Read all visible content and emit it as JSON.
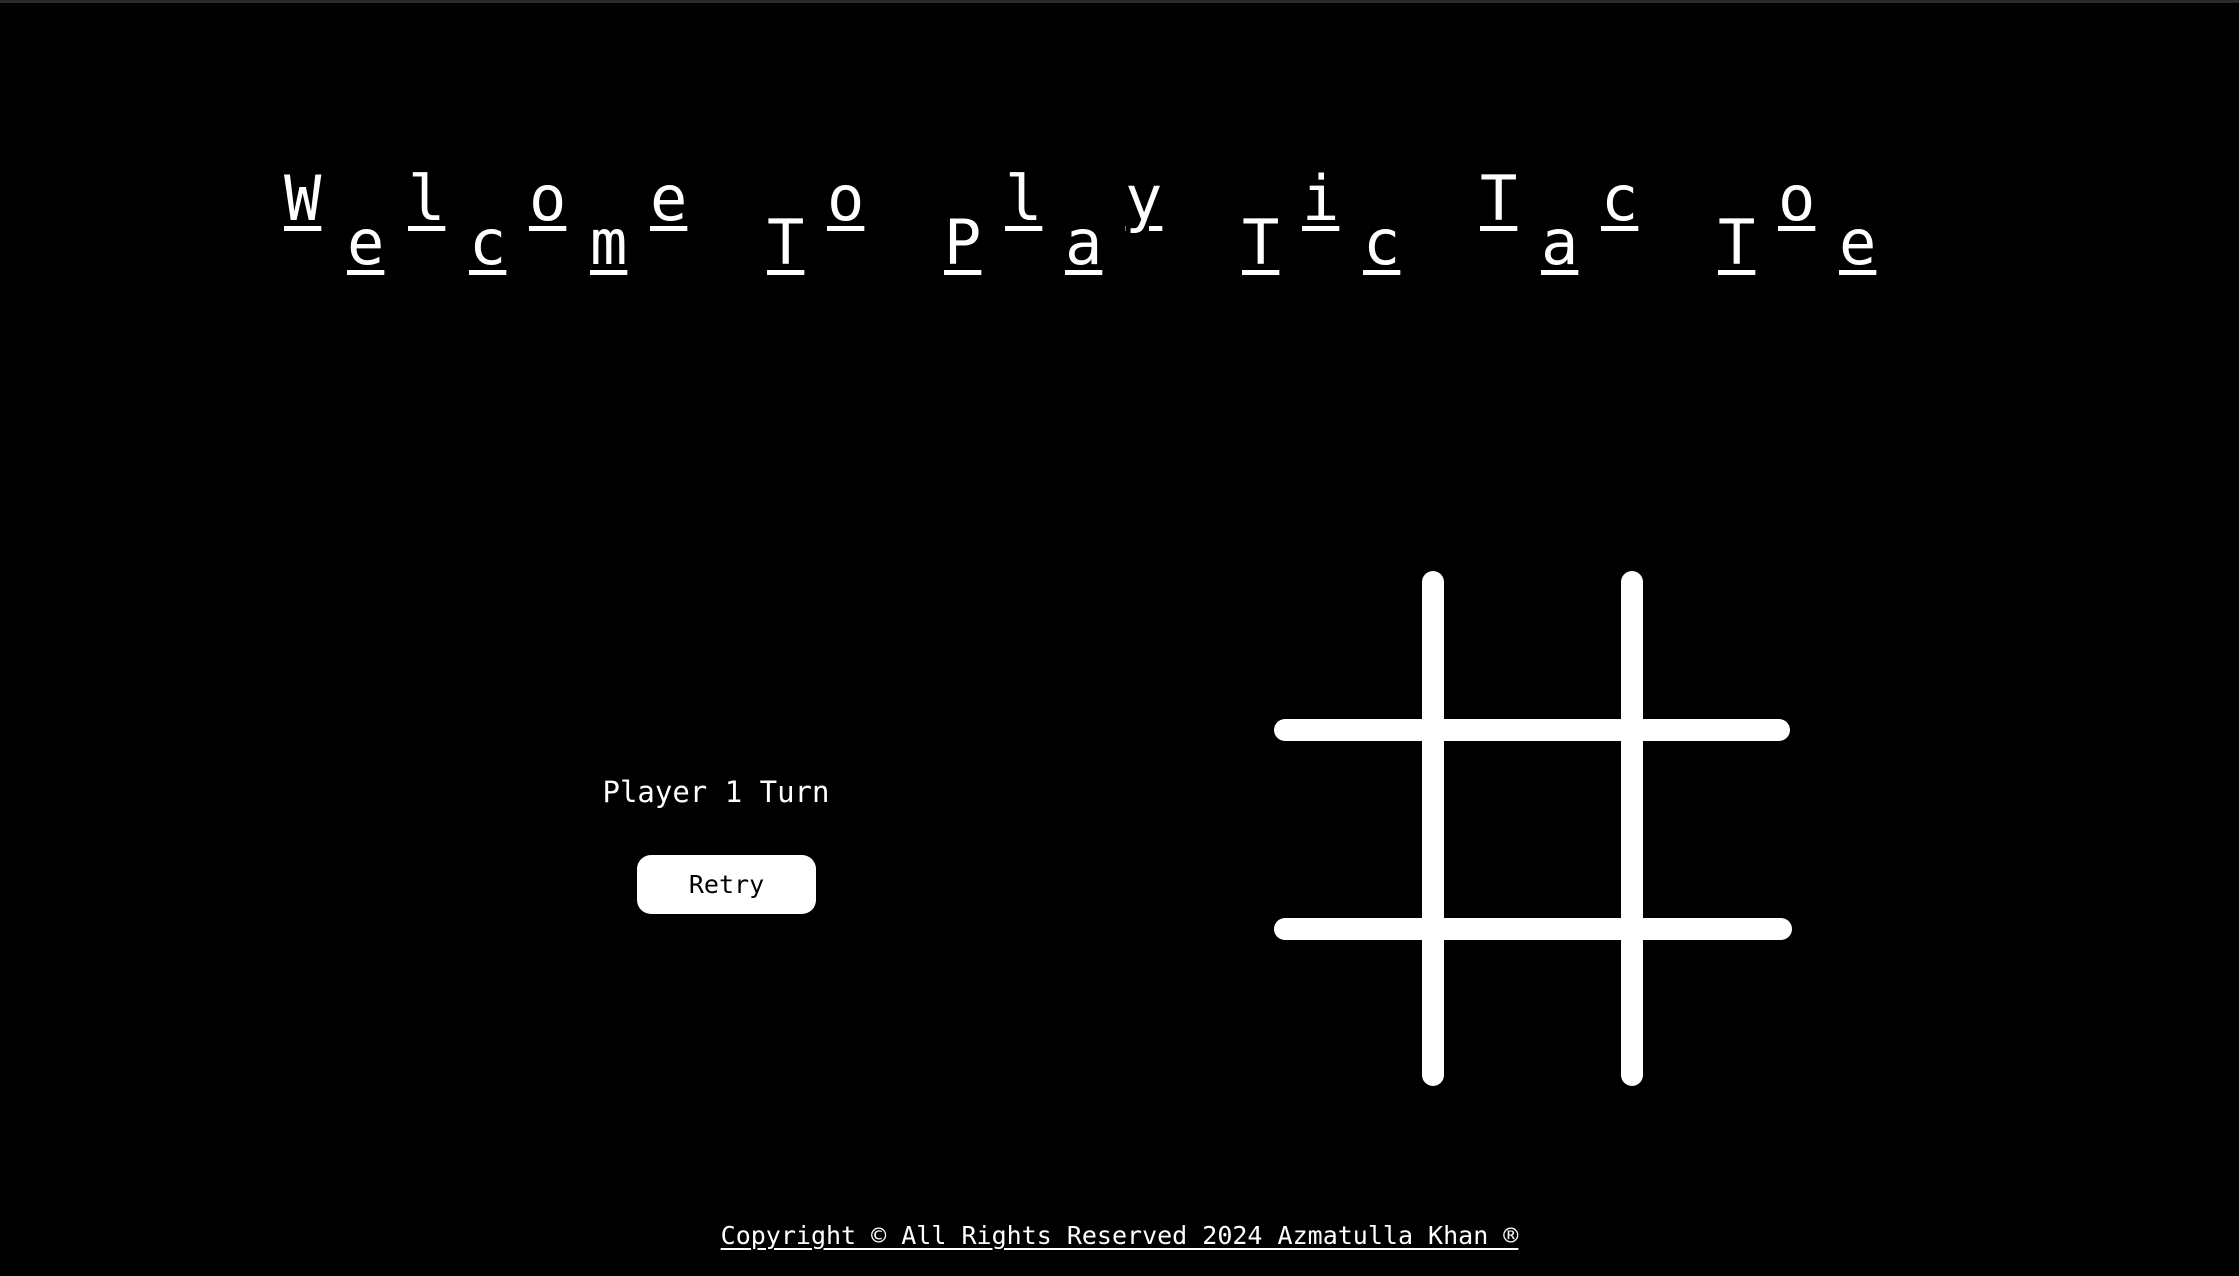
{
  "header": {
    "title": "Welcome To Play Tic Tac Toe",
    "title_chars": [
      "W",
      "e",
      "l",
      "c",
      "o",
      "m",
      "e",
      "T",
      "o",
      "P",
      "l",
      "a",
      "y",
      "T",
      "i",
      "c",
      "T",
      "a",
      "c",
      "T",
      "o",
      "e"
    ]
  },
  "game": {
    "status": "Player 1 Turn",
    "retry_label": "Retry",
    "cells": [
      "",
      "",
      "",
      "",
      "",
      "",
      "",
      "",
      ""
    ]
  },
  "footer": {
    "copyright": "Copyright © All Rights Reserved 2024 Azmatulla Khan ®"
  },
  "colors": {
    "background": "#000000",
    "foreground": "#ffffff",
    "button_text": "#000000"
  }
}
